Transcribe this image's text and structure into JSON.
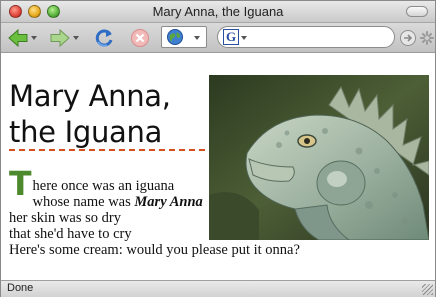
{
  "window": {
    "title": "Mary Anna, the Iguana"
  },
  "toolbar": {
    "back": "back-icon",
    "forward": "forward-icon",
    "reload": "reload-icon",
    "stop": "stop-icon",
    "site": "globe-icon",
    "search_engine": "G",
    "go": "go-icon",
    "activity": "spinner-icon"
  },
  "page": {
    "heading_line1": "Mary Anna,",
    "heading_line2": "the Iguana",
    "image": "iguana-photo",
    "poem": {
      "dropcap": "T",
      "line1_rest": "here once was an iguana",
      "line2_pre": "whose name was ",
      "line2_em": "Mary Anna",
      "line3": "her skin was so dry",
      "line4": "that she'd have to cry",
      "line5": "Here's some cream: would you please put it onna?"
    }
  },
  "status": {
    "text": "Done"
  },
  "colors": {
    "accent_green": "#4d8a2e",
    "divider_orange": "#d4501e"
  }
}
